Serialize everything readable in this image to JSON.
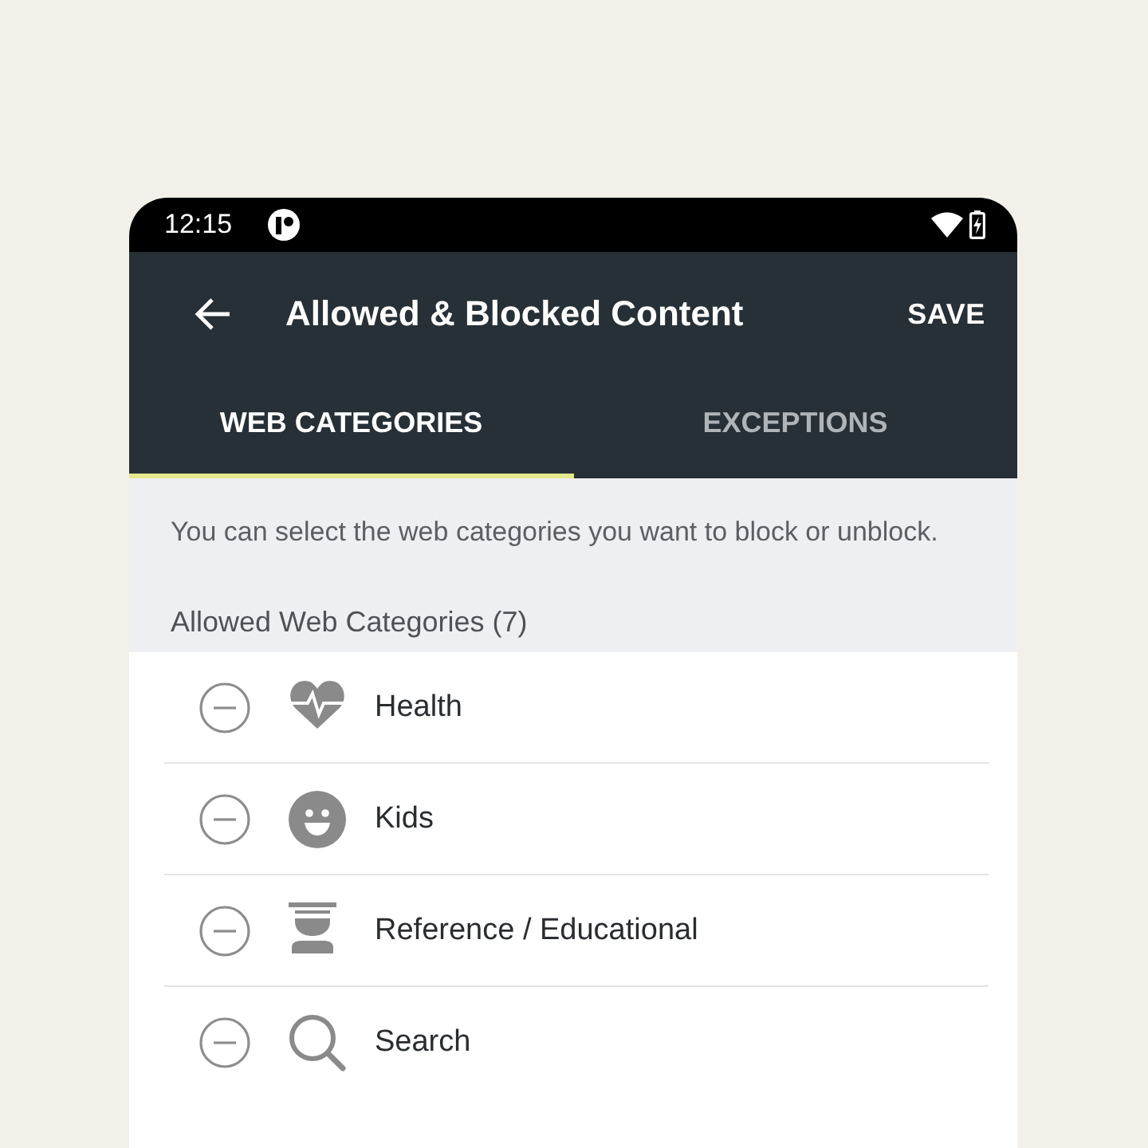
{
  "status_bar": {
    "time": "12:15"
  },
  "app_bar": {
    "title": "Allowed & Blocked Content",
    "action": "SAVE"
  },
  "tabs": [
    {
      "label": "WEB CATEGORIES",
      "selected": true
    },
    {
      "label": "EXCEPTIONS",
      "selected": false
    }
  ],
  "description": "You can select the web categories you want to block or unblock.",
  "section_title": "Allowed Web Categories (7)",
  "categories": [
    {
      "label": "Health",
      "kind": "health"
    },
    {
      "label": "Kids",
      "kind": "kids"
    },
    {
      "label": "Reference / Educational",
      "kind": "education"
    },
    {
      "label": "Search",
      "kind": "search"
    }
  ]
}
